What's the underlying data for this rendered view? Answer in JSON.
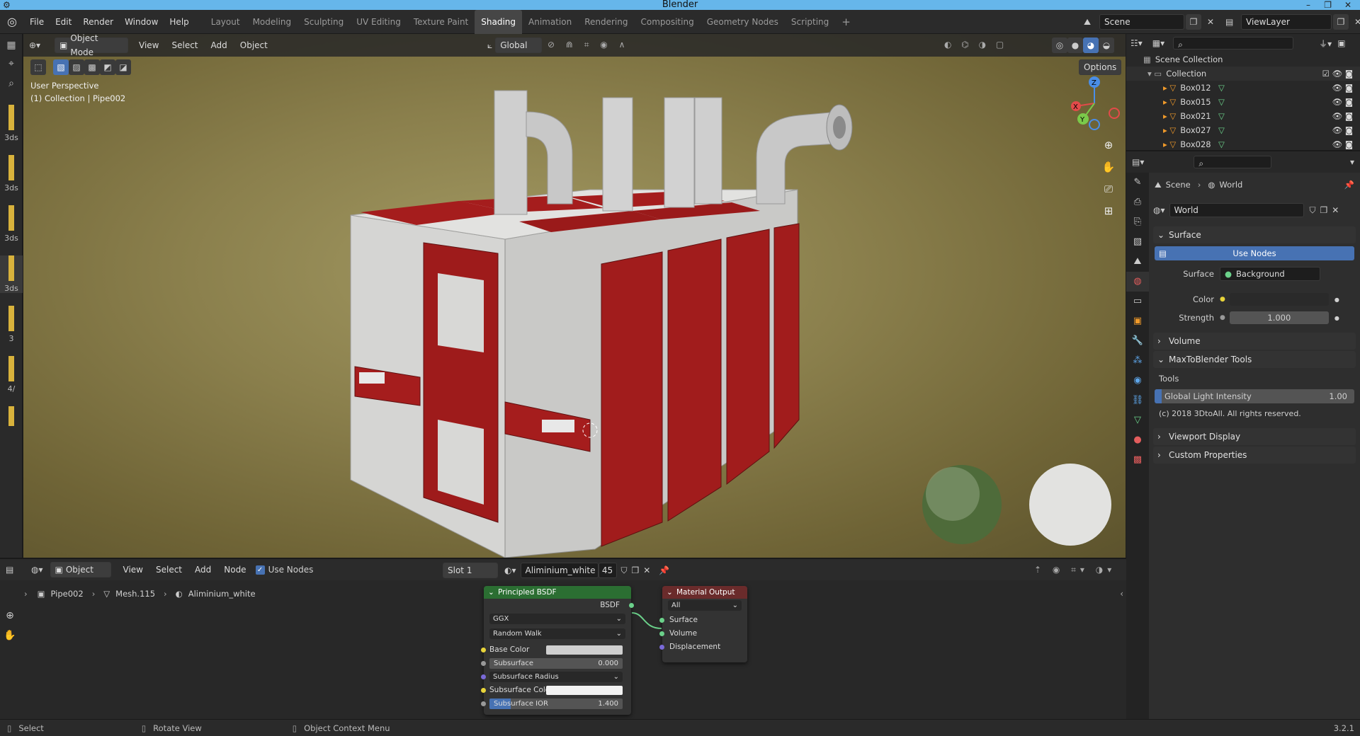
{
  "window": {
    "title": "Blender",
    "controls": [
      "–",
      "❐",
      "✕"
    ]
  },
  "menu": [
    "File",
    "Edit",
    "Render",
    "Window",
    "Help"
  ],
  "workspaces": [
    "Layout",
    "Modeling",
    "Sculpting",
    "UV Editing",
    "Texture Paint",
    "Shading",
    "Animation",
    "Rendering",
    "Compositing",
    "Geometry Nodes",
    "Scripting"
  ],
  "active_workspace": "Shading",
  "scene": {
    "scene_name": "Scene",
    "view_layer": "ViewLayer"
  },
  "viewport": {
    "mode": "Object Mode",
    "menus": [
      "View",
      "Select",
      "Add",
      "Object"
    ],
    "orientation": "Global",
    "options_label": "Options",
    "info_line1": "User Perspective",
    "info_line2": "(1) Collection | Pipe002",
    "gizmo_axes": [
      "X",
      "Y",
      "Z"
    ]
  },
  "left_toolbar_labels": [
    "3ds",
    "3ds",
    "3ds",
    "3ds",
    "3",
    "4/"
  ],
  "outliner": {
    "root": "Scene Collection",
    "collection": "Collection",
    "items": [
      "Box012",
      "Box015",
      "Box021",
      "Box027",
      "Box028"
    ]
  },
  "properties": {
    "breadcrumb_scene": "Scene",
    "breadcrumb_world": "World",
    "world_name": "World",
    "surface_section": "Surface",
    "use_nodes_label": "Use Nodes",
    "surface_label": "Surface",
    "surface_value": "Background",
    "color_label": "Color",
    "strength_label": "Strength",
    "strength_value": "1.000",
    "volume_section": "Volume",
    "maxtoblender_section": "MaxToBlender Tools",
    "tools_label": "Tools",
    "global_light_label": "Global Light Intensity",
    "global_light_value": "1.00",
    "copyright": "(c) 2018 3DtoAll. All rights reserved.",
    "viewport_display_section": "Viewport Display",
    "custom_props_section": "Custom Properties"
  },
  "node_header": {
    "mode": "Object",
    "menus": [
      "View",
      "Select",
      "Add",
      "Node"
    ],
    "use_nodes": "Use Nodes",
    "slot": "Slot 1",
    "material": "Aliminium_white",
    "users": "45"
  },
  "node_breadcrumb": {
    "object": "Pipe002",
    "mesh": "Mesh.115",
    "material": "Aliminium_white"
  },
  "bsdf_node": {
    "title": "Principled BSDF",
    "output": "BSDF",
    "distribution": "GGX",
    "subsurface_method": "Random Walk",
    "rows": [
      {
        "label": "Base Color",
        "value": ""
      },
      {
        "label": "Subsurface",
        "value": "0.000"
      },
      {
        "label": "Subsurface Radius",
        "value": ""
      },
      {
        "label": "Subsurface Colo",
        "value": ""
      },
      {
        "label": "Subsurface IOR",
        "value": "1.400"
      }
    ]
  },
  "output_node": {
    "title": "Material Output",
    "target": "All",
    "inputs": [
      "Surface",
      "Volume",
      "Displacement"
    ]
  },
  "statusbar": {
    "select": "Select",
    "rotate": "Rotate View",
    "context": "Object Context Menu",
    "version": "3.2.1"
  },
  "colors": {
    "accent": "#4772b3",
    "node_green": "#2b6e32",
    "node_red": "#6a2b2b",
    "titlebar": "#66b6ea"
  }
}
